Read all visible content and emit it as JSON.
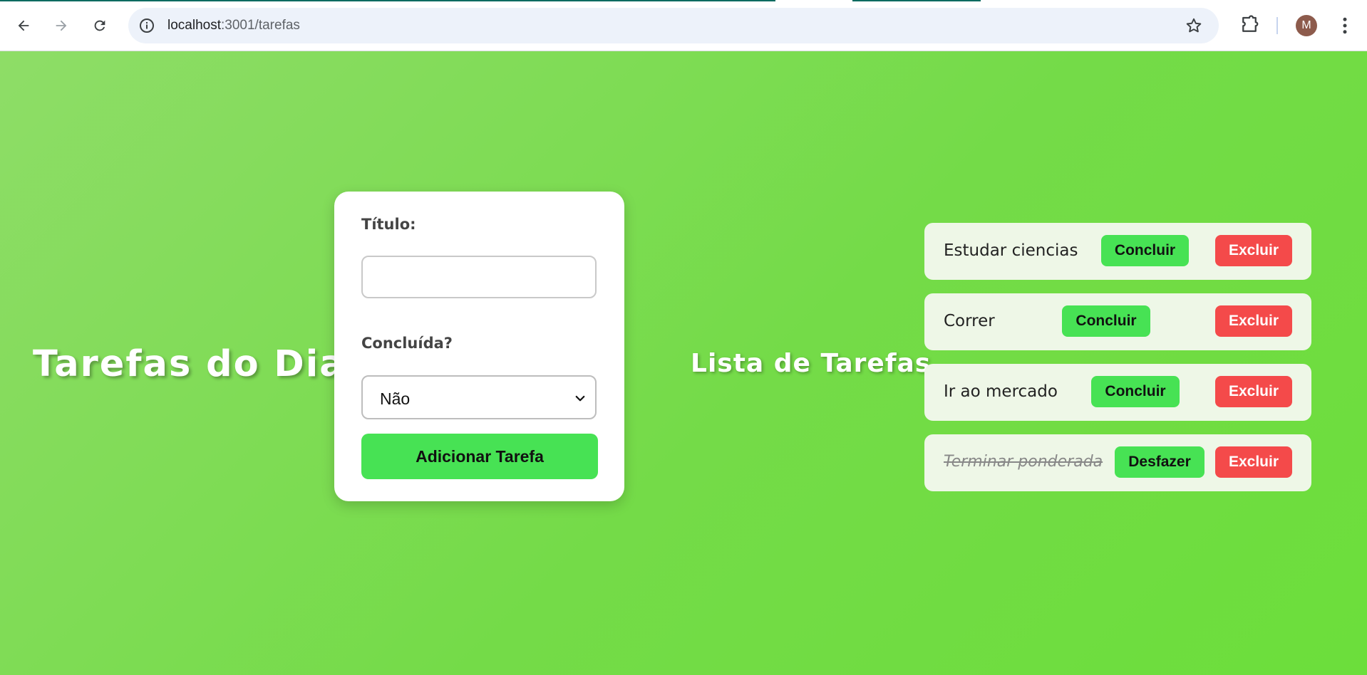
{
  "browser": {
    "url_host": "localhost",
    "url_rest": ":3001/tarefas",
    "profile_initial": "M",
    "accent_color": "#0b6b61"
  },
  "page": {
    "main_title": "Tarefas do Dia",
    "form": {
      "title_label": "Título:",
      "title_value": "",
      "done_label": "Concluída?",
      "done_selected": "Não",
      "submit_label": "Adicionar Tarefa"
    },
    "list_title": "Lista de Tarefas",
    "tasks": [
      {
        "title": "Estudar ciencias",
        "done": false,
        "action_label": "Concluir",
        "delete_label": "Excluir"
      },
      {
        "title": "Correr",
        "done": false,
        "action_label": "Concluir",
        "delete_label": "Excluir"
      },
      {
        "title": "Ir ao mercado",
        "done": false,
        "action_label": "Concluir",
        "delete_label": "Excluir"
      },
      {
        "title": "Terminar ponderada",
        "done": true,
        "action_label": "Desfazer",
        "delete_label": "Excluir"
      }
    ]
  },
  "colors": {
    "background_start": "#8edd67",
    "background_end": "#6cde3b",
    "green_button": "#47e254",
    "red_button": "#f44a4a",
    "task_card": "#eef7e7"
  },
  "icons": [
    "back-arrow-icon",
    "forward-arrow-icon",
    "reload-icon",
    "site-info-icon",
    "bookmark-star-icon",
    "extensions-icon",
    "more-menu-icon",
    "chevron-down-icon"
  ]
}
